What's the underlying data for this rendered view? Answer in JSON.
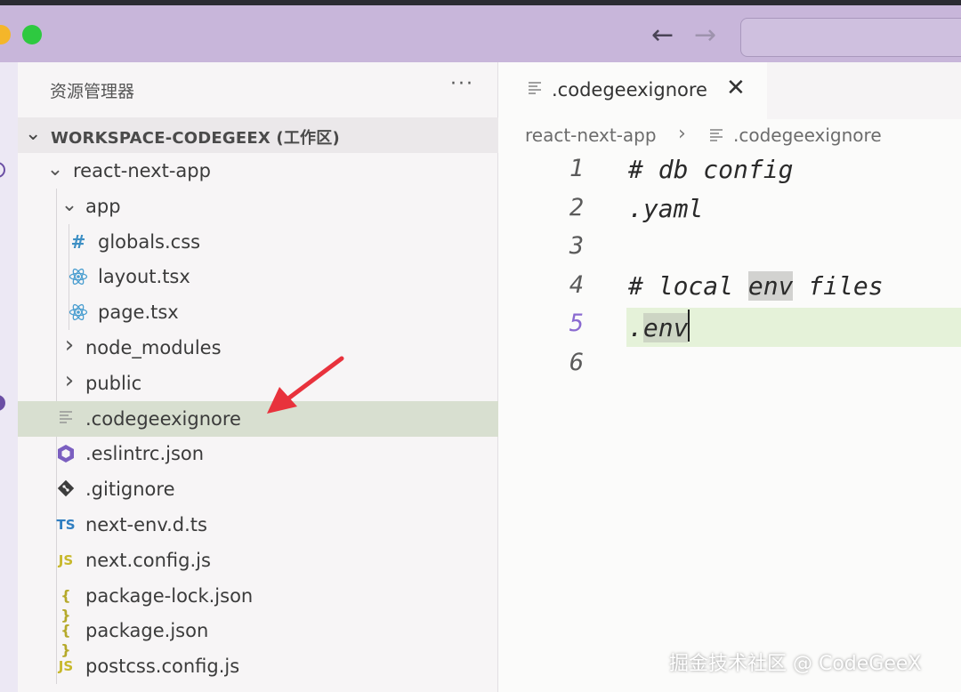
{
  "explorer": {
    "title": "资源管理器",
    "more_icon": "ellipsis-icon",
    "workspace_label": "WORKSPACE-CODEGEEX (工作区)",
    "items": [
      {
        "name": "react-next-app",
        "type": "folder-open",
        "depth": 1
      },
      {
        "name": "app",
        "type": "folder-open",
        "depth": 2
      },
      {
        "name": "globals.css",
        "type": "file",
        "icon": "css-hash-icon",
        "icon_text": "#",
        "depth": 3
      },
      {
        "name": "layout.tsx",
        "type": "file",
        "icon": "react-icon",
        "depth": 3
      },
      {
        "name": "page.tsx",
        "type": "file",
        "icon": "react-icon",
        "depth": 3
      },
      {
        "name": "node_modules",
        "type": "folder-closed",
        "depth": 2
      },
      {
        "name": "public",
        "type": "folder-closed",
        "depth": 2
      },
      {
        "name": ".codegeexignore",
        "type": "file",
        "icon": "text-lines-icon",
        "depth": 2,
        "selected": true
      },
      {
        "name": ".eslintrc.json",
        "type": "file",
        "icon": "eslint-icon",
        "depth": 2
      },
      {
        "name": ".gitignore",
        "type": "file",
        "icon": "git-icon",
        "depth": 2
      },
      {
        "name": "next-env.d.ts",
        "type": "file",
        "icon": "typescript-icon",
        "icon_text": "TS",
        "depth": 2
      },
      {
        "name": "next.config.js",
        "type": "file",
        "icon": "javascript-icon",
        "icon_text": "JS",
        "depth": 2
      },
      {
        "name": "package-lock.json",
        "type": "file",
        "icon": "json-braces-icon",
        "icon_text": "{ }",
        "depth": 2
      },
      {
        "name": "package.json",
        "type": "file",
        "icon": "json-braces-icon",
        "icon_text": "{ }",
        "depth": 2
      },
      {
        "name": "postcss.config.js",
        "type": "file",
        "icon": "javascript-icon",
        "icon_text": "JS",
        "depth": 2
      }
    ]
  },
  "editor": {
    "tab": {
      "name": ".codegeexignore",
      "close_glyph": "✕"
    },
    "breadcrumb": {
      "folder": "react-next-app",
      "separator": "›",
      "file": ".codegeexignore"
    },
    "lines": [
      {
        "no": "1",
        "text": "# db config"
      },
      {
        "no": "2",
        "text": ".yaml"
      },
      {
        "no": "3",
        "text": ""
      },
      {
        "no": "4",
        "pre": "# local ",
        "hl": "env",
        "post": " files"
      },
      {
        "no": "5",
        "pre": ".",
        "hl": "env",
        "post": "",
        "active": true
      },
      {
        "no": "6",
        "text": ""
      }
    ]
  },
  "titlebar": {
    "back_glyph": "←",
    "forward_glyph": "→"
  },
  "watermark": "掘金技术社区 @ CodeGeeX",
  "colors": {
    "titlebar": "#c8b6da",
    "selected_row": "#d8dfd0",
    "active_line": "#e5f2d9",
    "arrow": "#e8323c"
  }
}
